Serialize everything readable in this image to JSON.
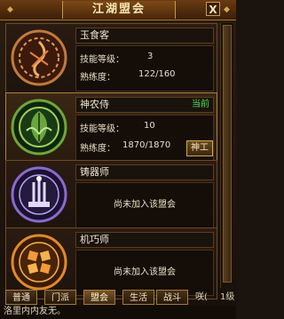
{
  "window": {
    "title": "江湖盟会",
    "help_label": "?",
    "close_label": "X"
  },
  "skills": [
    {
      "name": "玉食客",
      "level_label": "技能等级：",
      "level_value": "3",
      "exp_label": "熟练度：",
      "exp_value": "122/160",
      "icon": "food-chef-emblem-icon",
      "status": "",
      "action": ""
    },
    {
      "name": "神农侍",
      "level_label": "技能等级：",
      "level_value": "10",
      "exp_label": "熟练度：",
      "exp_value": "1870/1870",
      "icon": "herbal-leaf-emblem-icon",
      "status": "当前",
      "action": "神工"
    },
    {
      "name": "铸器师",
      "unjoined": "尚未加入该盟会",
      "icon": "forging-tools-emblem-icon"
    },
    {
      "name": "机巧师",
      "unjoined": "尚未加入该盟会",
      "icon": "mechanism-gear-emblem-icon"
    }
  ],
  "tabs": [
    {
      "label": "普通"
    },
    {
      "label": "门派"
    },
    {
      "label": "盟会"
    },
    {
      "label": "生活"
    },
    {
      "label": "战斗"
    }
  ],
  "tab_extra": "咲(",
  "tab_extra2": "1级",
  "bottom_text": "洛里内内友无。",
  "colors": {
    "current_status": "#46e44c",
    "border_gold": "#c49a47"
  }
}
